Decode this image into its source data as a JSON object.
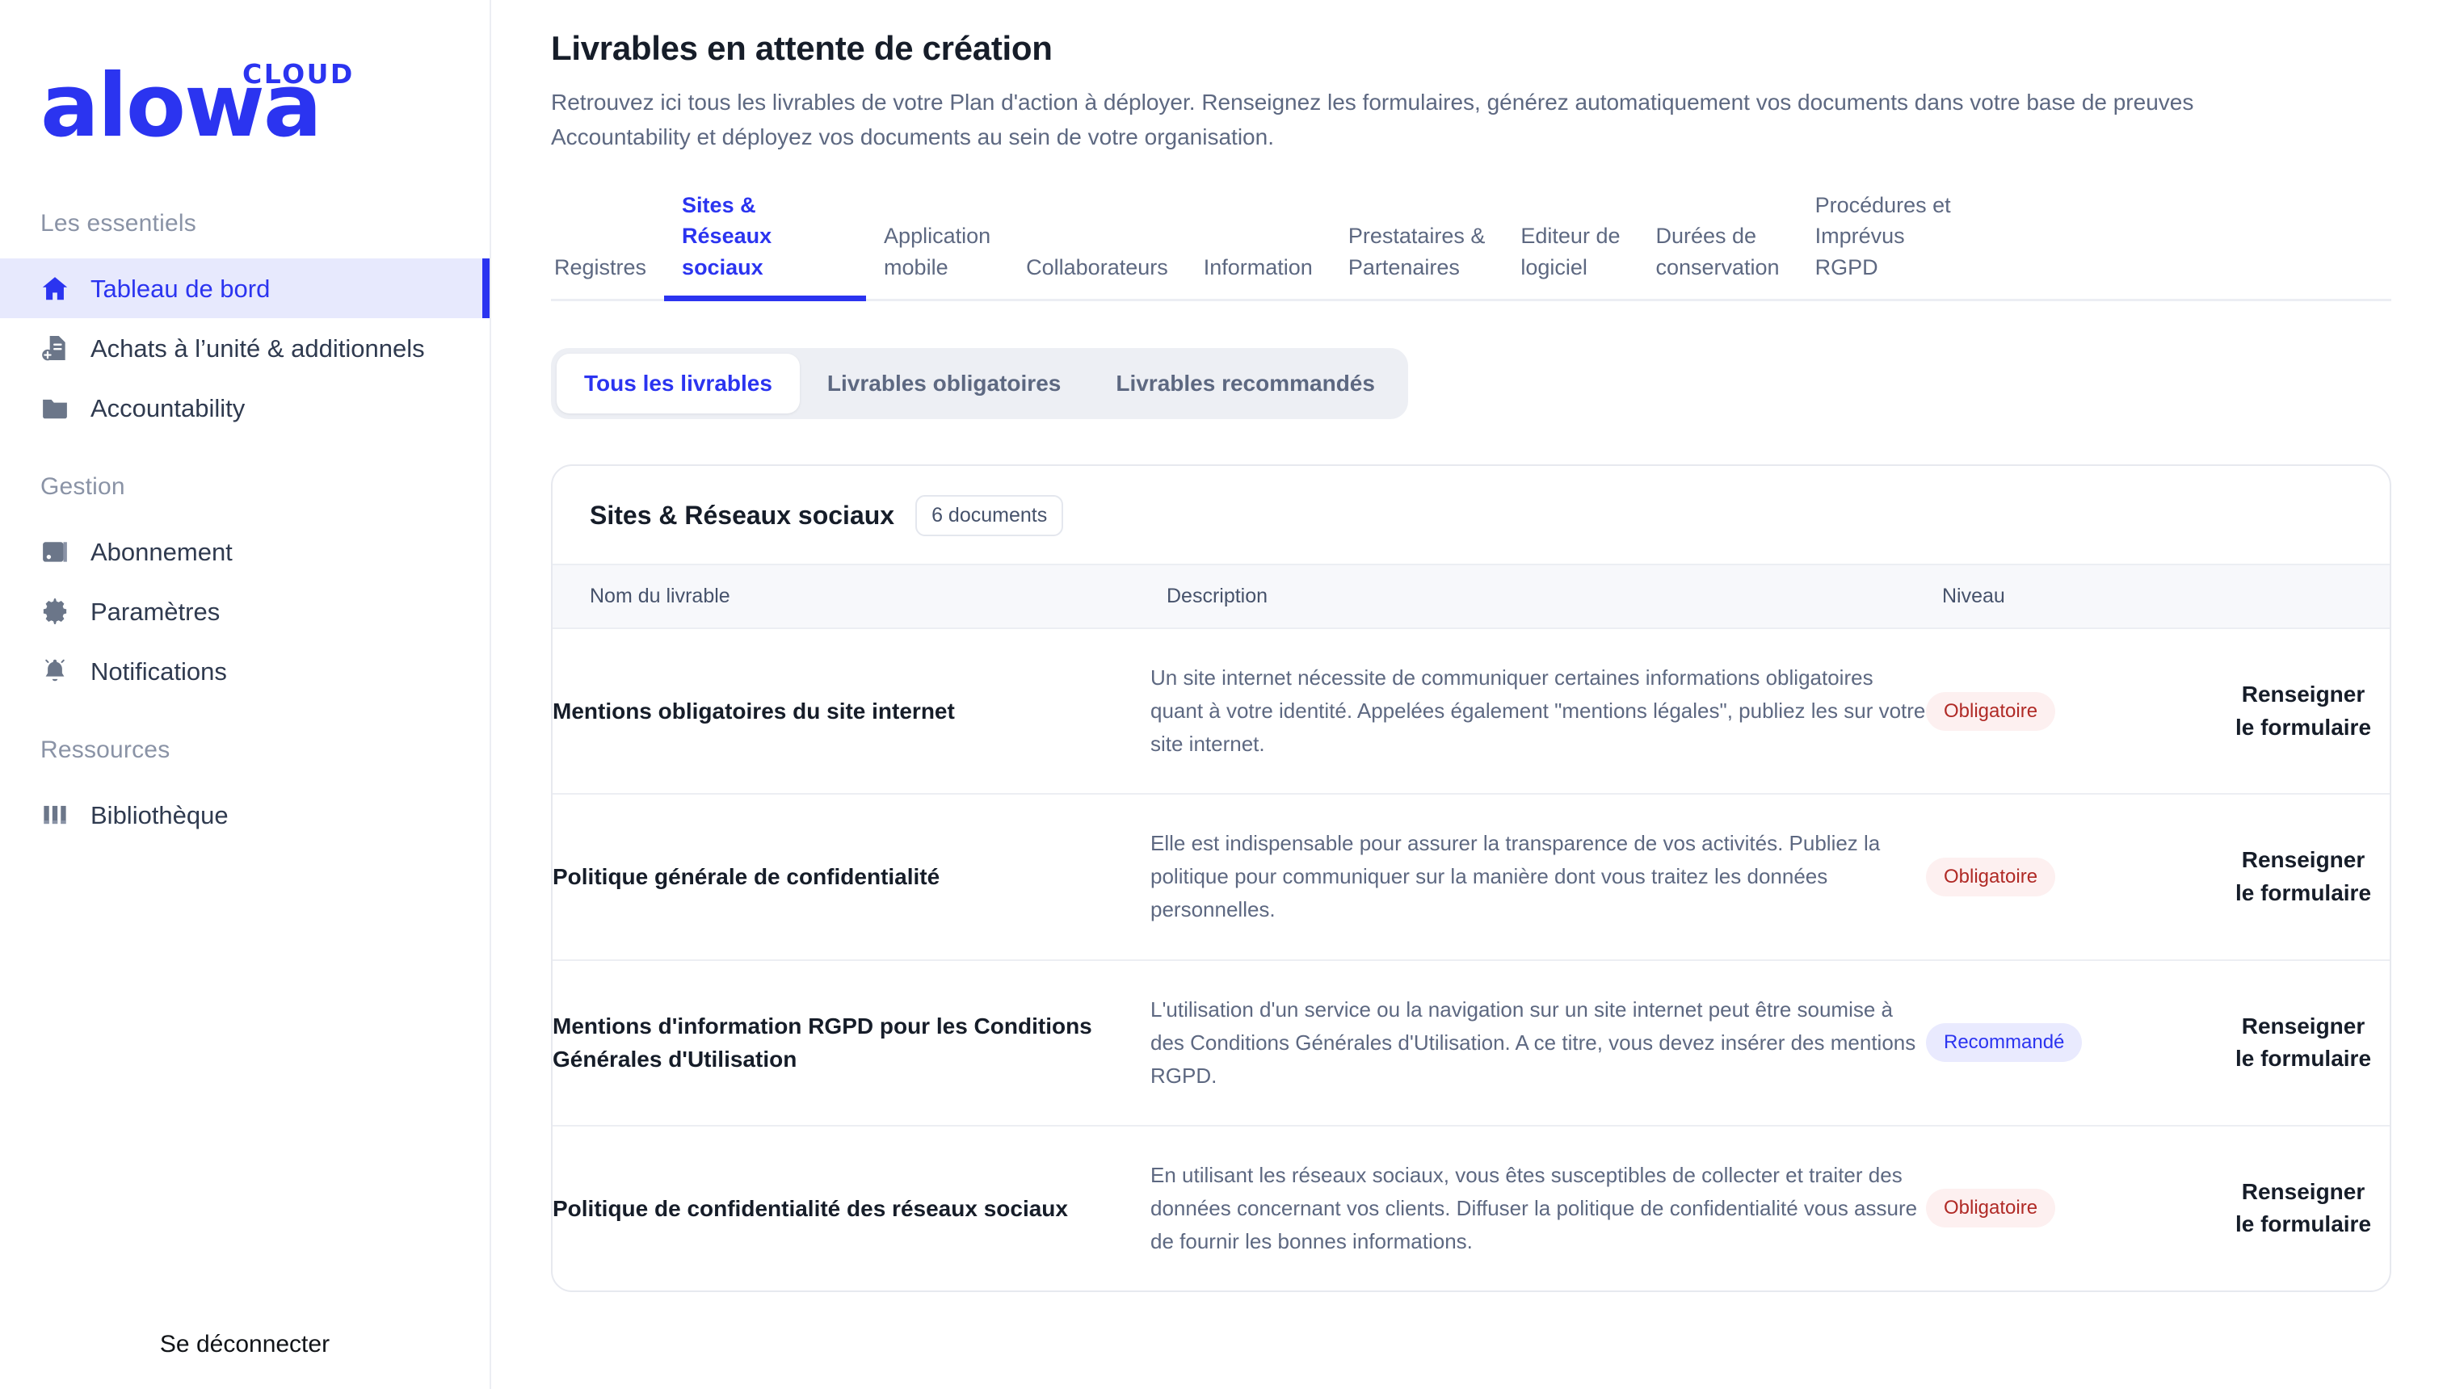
{
  "brand": {
    "name": "alowa",
    "suffix": "CLOUD"
  },
  "sidebar": {
    "sections": [
      {
        "title": "Les essentiels",
        "items": [
          {
            "label": "Tableau de bord",
            "icon": "home-icon",
            "active": true
          },
          {
            "label": "Achats à l’unité & additionnels",
            "icon": "document-plus-icon",
            "active": false
          },
          {
            "label": "Accountability",
            "icon": "folder-icon",
            "active": false
          }
        ]
      },
      {
        "title": "Gestion",
        "items": [
          {
            "label": "Abonnement",
            "icon": "wallet-icon",
            "active": false
          },
          {
            "label": "Paramètres",
            "icon": "gear-icon",
            "active": false
          },
          {
            "label": "Notifications",
            "icon": "bell-icon",
            "active": false
          }
        ]
      },
      {
        "title": "Ressources",
        "items": [
          {
            "label": "Bibliothèque",
            "icon": "books-icon",
            "active": false
          }
        ]
      }
    ],
    "logout_label": "Se déconnecter"
  },
  "header": {
    "title": "Livrables en attente de création",
    "subtitle": "Retrouvez ici tous les livrables de votre Plan d'action à déployer. Renseignez les formulaires, générez automatiquement vos documents dans votre base de preuves Accountability et déployez vos documents au sein de votre organisation."
  },
  "tabs": [
    {
      "label": "Registres",
      "active": false
    },
    {
      "label": "Sites & Réseaux\nsociaux",
      "active": true
    },
    {
      "label": "Application\nmobile",
      "active": false
    },
    {
      "label": "Collaborateurs",
      "active": false
    },
    {
      "label": "Information",
      "active": false
    },
    {
      "label": "Prestataires &\nPartenaires",
      "active": false
    },
    {
      "label": "Editeur de\nlogiciel",
      "active": false
    },
    {
      "label": "Durées de\nconservation",
      "active": false
    },
    {
      "label": "Procédures et Imprévus\nRGPD",
      "active": false
    }
  ],
  "filters": [
    {
      "label": "Tous les livrables",
      "active": true
    },
    {
      "label": "Livrables obligatoires",
      "active": false
    },
    {
      "label": "Livrables recommandés",
      "active": false
    }
  ],
  "card": {
    "title": "Sites & Réseaux sociaux",
    "count_badge": "6 documents",
    "columns": {
      "name": "Nom du livrable",
      "description": "Description",
      "level": "Niveau",
      "action": ""
    },
    "rows": [
      {
        "name": "Mentions obligatoires du site internet",
        "description": "Un site internet nécessite de communiquer certaines informations obligatoires quant à votre identité. Appelées également \"mentions légales\", publiez les sur votre site internet.",
        "level": "Obligatoire",
        "level_kind": "obligatoire",
        "action": "Renseigner\nle formulaire"
      },
      {
        "name": "Politique générale de confidentialité",
        "description": "Elle est indispensable pour assurer la transparence de vos activités. Publiez la politique pour communiquer sur la manière dont vous traitez les données personnelles.",
        "level": "Obligatoire",
        "level_kind": "obligatoire",
        "action": "Renseigner\nle formulaire"
      },
      {
        "name": "Mentions d'information RGPD pour les Conditions Générales d'Utilisation",
        "description": "L'utilisation d'un service ou la navigation sur un site internet peut être soumise à des Conditions Générales d'Utilisation. A ce titre, vous devez insérer des mentions RGPD.",
        "level": "Recommandé",
        "level_kind": "recommande",
        "action": "Renseigner\nle formulaire"
      },
      {
        "name": "Politique de confidentialité des réseaux sociaux",
        "description": "En utilisant les réseaux sociaux, vous êtes susceptibles de collecter et traiter des données concernant vos clients. Diffuser la politique de confidentialité vous assure de fournir les bonnes informations.",
        "level": "Obligatoire",
        "level_kind": "obligatoire",
        "action": "Renseigner\nle formulaire"
      }
    ]
  },
  "colors": {
    "brand_blue": "#2b34f0",
    "active_nav_bg": "#e7e9fd",
    "obligatoire_bg": "#fdf0f0",
    "obligatoire_fg": "#b02a26",
    "recommande_bg": "#e9eafe",
    "recommande_fg": "#2b34f0"
  }
}
